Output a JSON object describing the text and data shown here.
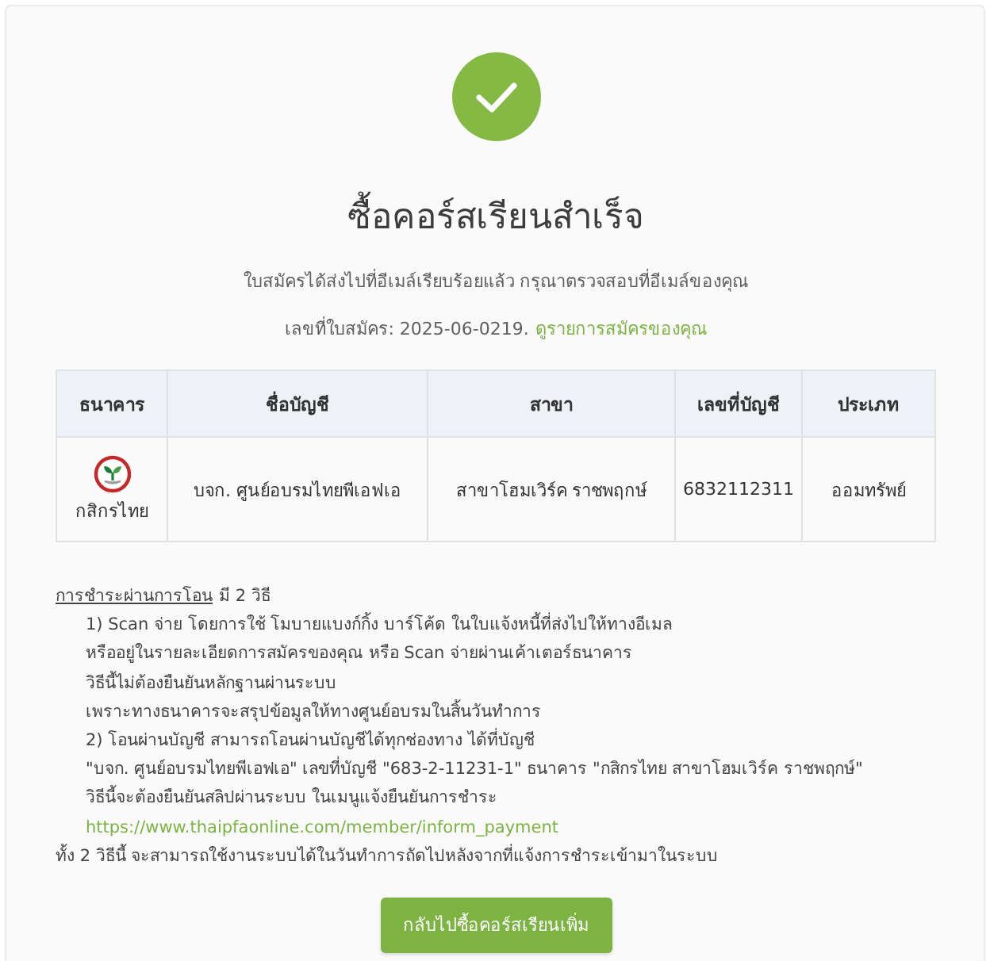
{
  "status": {
    "title": "ซื้อคอร์สเรียนสำเร็จ",
    "message": "ใบสมัครได้ส่งไปที่อีเมล์เรียบร้อยแล้ว กรุณาตรวจสอบที่อีเมล์ของคุณ",
    "application_number": "เลขที่ใบสมัคร: 2025-06-0219.",
    "application_link": "ดูรายการสมัครของคุณ"
  },
  "table": {
    "columns": [
      "ธนาคาร",
      "ชื่อบัญชี",
      "สาขา",
      "เลขที่บัญชี",
      "ประเภท"
    ],
    "rows": [
      {
        "cells": [
          {
            "kind": "bank",
            "text": "กสิกรไทย"
          },
          {
            "kind": "text",
            "text": "บจก. ศูนย์อบรมไทยพีเอฟเอ"
          },
          {
            "kind": "text",
            "text": "สาขาโฮมเวิร์ค ราชพฤกษ์"
          },
          {
            "kind": "text",
            "text": "6832112311"
          },
          {
            "kind": "text",
            "text": "ออมทรัพย์"
          }
        ]
      }
    ]
  },
  "payment": {
    "heading": "การชำระผ่านการโอน",
    "heading_note": "มี 2 วิธี",
    "steps": [
      {
        "kind": "text",
        "text": "1) Scan จ่าย โดยการใช้ โมบายแบงก์กิ้ง บาร์โค้ด ในใบแจ้งหนี้ที่ส่งไปให้ทางอีเมล"
      },
      {
        "kind": "text",
        "text": "หรืออยู่ในรายละเอียดการสมัครของคุณ หรือ Scan จ่ายผ่านเค้าเตอร์ธนาคาร"
      },
      {
        "kind": "text",
        "text": "วิธีนี้ไม่ต้องยืนยันหลักฐานผ่านระบบ"
      },
      {
        "kind": "text",
        "text": "เพราะทางธนาคารจะสรุปข้อมูลให้ทางศูนย์อบรมในสิ้นวันทำการ"
      },
      {
        "kind": "text",
        "text": "2) โอนผ่านบัญชี สามารถโอนผ่านบัญชีได้ทุกช่องทาง ได้ที่บัญชี"
      },
      {
        "kind": "text",
        "text": "\"บจก. ศูนย์อบรมไทยพีเอฟเอ\" เลขที่บัญชี \"683-2-11231-1\" ธนาคาร \"กสิกรไทย สาขาโฮมเวิร์ค ราชพฤกษ์\""
      },
      {
        "kind": "text",
        "text": "วิธีนี้จะต้องยืนยันสลิปผ่านระบบ ในเมนูแจ้งยืนยันการชำระ"
      },
      {
        "kind": "link",
        "text": "https://www.thaipfaonline.com/member/inform_payment"
      }
    ],
    "footer": "ทั้ง 2 วิธีนี้ จะสามารถใช้งานระบบได้ในวันทำการถัดไปหลังจากที่แจ้งการชำระเข้ามาในระบบ"
  },
  "button": {
    "label": "กลับไปซื้อคอร์สเรียนเพิ่ม"
  }
}
